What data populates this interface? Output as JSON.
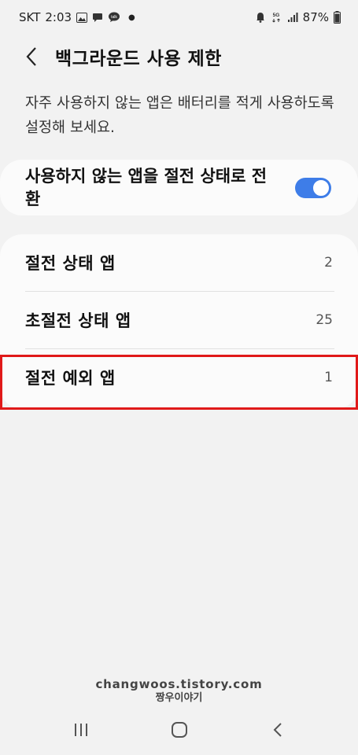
{
  "status_bar": {
    "carrier": "SKT",
    "time": "2:03",
    "battery": "87%",
    "network": "5G",
    "icons": [
      "image-icon",
      "chat-icon",
      "talk-icon",
      "dot-icon",
      "alarm-icon",
      "5g-icon",
      "signal-icon",
      "battery-icon"
    ]
  },
  "header": {
    "back_icon": "chevron-left-icon",
    "title": "백그라운드 사용 제한"
  },
  "description": "자주 사용하지 않는 앱은 배터리를 적게 사용하도록 설정해 보세요.",
  "toggle": {
    "label": "사용하지 않는 앱을 절전 상태로 전환",
    "enabled": true
  },
  "list": {
    "items": [
      {
        "label": "절전 상태 앱",
        "count": "2"
      },
      {
        "label": "초절전 상태 앱",
        "count": "25"
      },
      {
        "label": "절전 예외 앱",
        "count": "1"
      }
    ]
  },
  "highlight_color": "#e01919",
  "accent_color": "#3e7de8",
  "watermark": {
    "url": "changwoos.tistory.com",
    "name": "짱우이야기"
  },
  "nav": {
    "icons": [
      "recents-icon",
      "home-icon",
      "back-icon"
    ]
  }
}
